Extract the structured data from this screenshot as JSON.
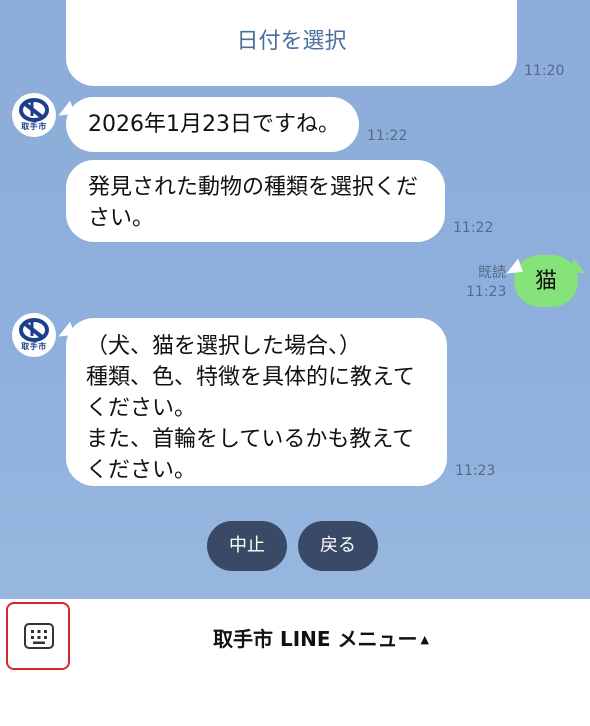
{
  "messages": [
    {
      "id": "date-select",
      "text": "日付を選択",
      "time": "11:20"
    },
    {
      "id": "msg1",
      "text": "2026年1月23日ですね。",
      "time": "11:22"
    },
    {
      "id": "msg2",
      "text": "発見された動物の種類を選択ください。",
      "line1": "発見された動物の種類を選択くだ",
      "line2": "さい。",
      "time": "11:22"
    },
    {
      "id": "user1",
      "text": "猫",
      "read": "既読",
      "time": "11:23"
    },
    {
      "id": "msg3",
      "lines": [
        "（犬、猫を選択した場合、）",
        "種類、色、特徴を具体的に教えて",
        "ください。",
        "また、首輪をしているかも教えて",
        "ください。"
      ],
      "time": "11:23"
    }
  ],
  "avatar": {
    "label": "取手市"
  },
  "quick_replies": [
    {
      "label": "中止"
    },
    {
      "label": "戻る"
    }
  ],
  "menu": {
    "title": "取手市 LINE メニュー",
    "indicator": "▲"
  },
  "colors": {
    "chat_bg": "#8fb0dc",
    "user_bubble": "#85e37a",
    "pill": "#3a4a66",
    "highlight": "#d8262b",
    "link": "#4a6e9e"
  }
}
